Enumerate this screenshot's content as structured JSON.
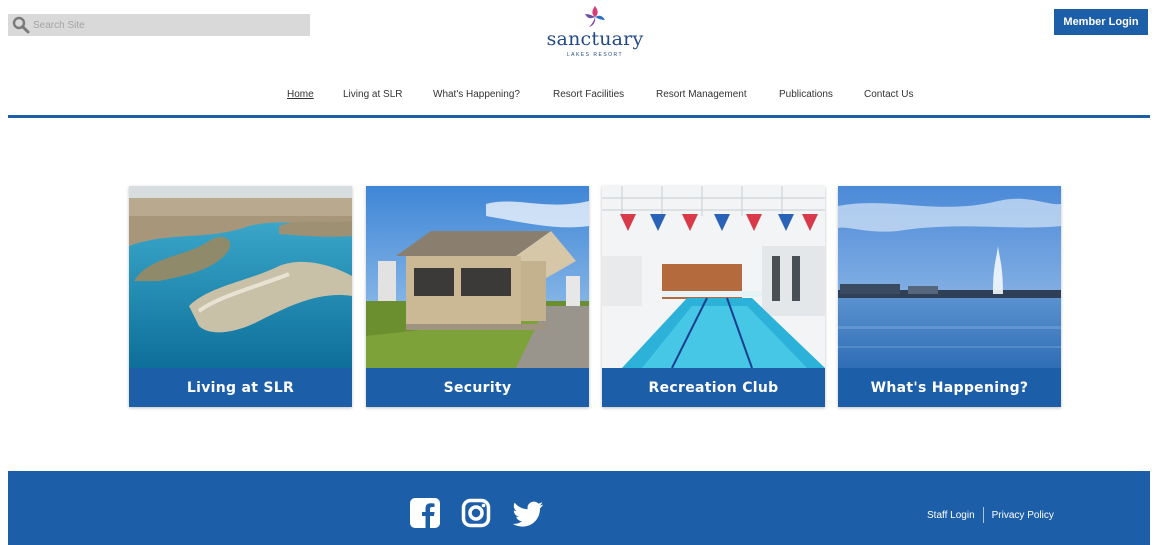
{
  "header": {
    "search_placeholder": "Search Site",
    "logo_word": "sanctuary",
    "logo_sub": "LAKES RESORT",
    "member_login": "Member Login"
  },
  "nav": {
    "items": [
      {
        "label": "Home",
        "active": true
      },
      {
        "label": "Living at SLR"
      },
      {
        "label": "What's Happening?"
      },
      {
        "label": "Resort Facilities"
      },
      {
        "label": "Resort Management"
      },
      {
        "label": "Publications"
      },
      {
        "label": "Contact Us"
      }
    ]
  },
  "tiles": [
    {
      "label": "Living at SLR"
    },
    {
      "label": "Security"
    },
    {
      "label": "Recreation Club"
    },
    {
      "label": "What's Happening?"
    }
  ],
  "footer": {
    "social": [
      "facebook-icon",
      "instagram-icon",
      "twitter-icon"
    ],
    "staff_login": "Staff Login",
    "privacy_policy": "Privacy Policy"
  },
  "colors": {
    "brand_blue": "#1d5ea8",
    "search_bg": "#d9d9d9"
  }
}
